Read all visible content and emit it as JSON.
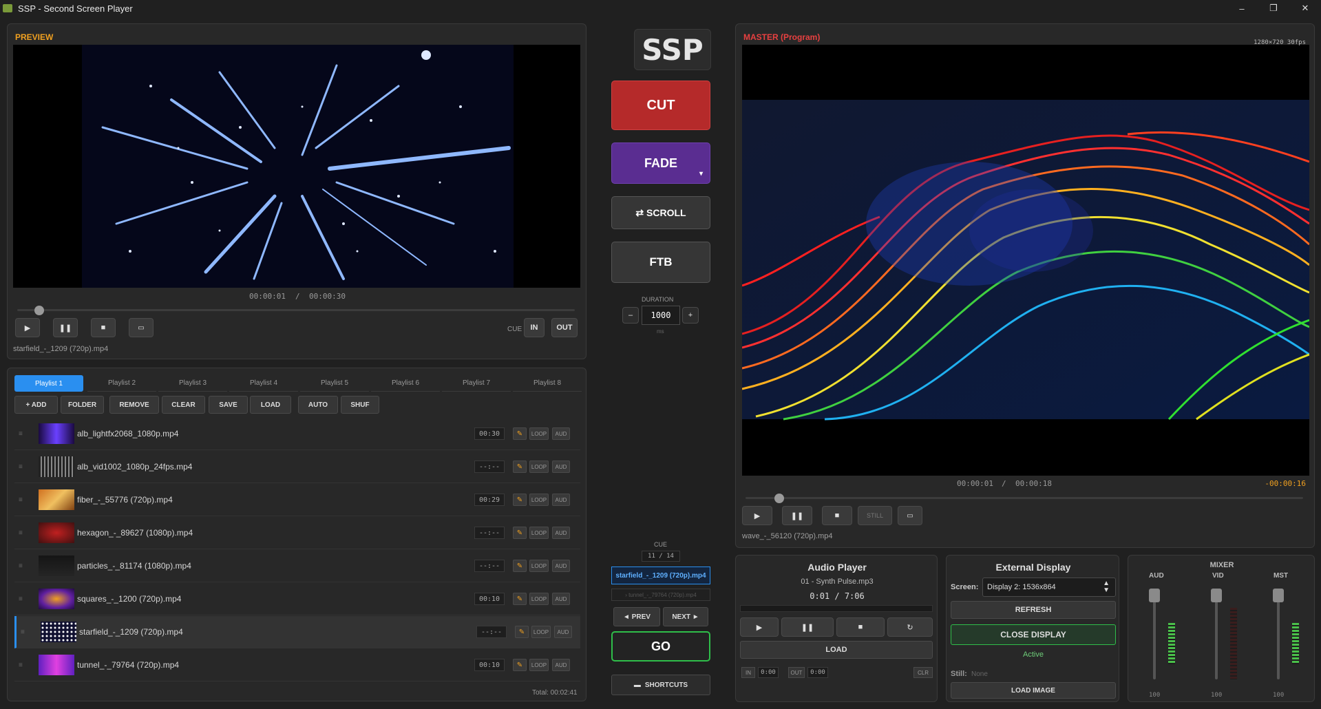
{
  "window": {
    "title": "SSP - Second Screen Player",
    "min": "–",
    "max": "❐",
    "close": "✕"
  },
  "preview": {
    "title": "PREVIEW",
    "time_current": "00:00:01",
    "time_sep": "/",
    "time_total": "00:00:30",
    "progress": 0.04,
    "filename": "starfield_-_1209 (720p).mp4",
    "cue_label": "CUE",
    "in_label": "IN",
    "out_label": "OUT"
  },
  "playlist": {
    "tabs": [
      "Playlist 1",
      "Playlist 2",
      "Playlist 3",
      "Playlist 4",
      "Playlist 5",
      "Playlist 6",
      "Playlist 7",
      "Playlist 8"
    ],
    "actions": [
      "+ ADD",
      "FOLDER",
      "REMOVE",
      "CLEAR",
      "SAVE",
      "LOAD",
      "AUTO",
      "SHUF"
    ],
    "loop_label": "LOOP",
    "aud_label": "AUD",
    "items": [
      {
        "name": "alb_lightfx2068_1080p.mp4",
        "duration": "00:30"
      },
      {
        "name": "alb_vid1002_1080p_24fps.mp4",
        "duration": "--:--"
      },
      {
        "name": "fiber_-_55776 (720p).mp4",
        "duration": "00:29"
      },
      {
        "name": "hexagon_-_89627 (1080p).mp4",
        "duration": "--:--"
      },
      {
        "name": "particles_-_81174 (1080p).mp4",
        "duration": "--:--"
      },
      {
        "name": "squares_-_1200 (720p).mp4",
        "duration": "00:10"
      },
      {
        "name": "starfield_-_1209 (720p).mp4",
        "duration": "--:--"
      },
      {
        "name": "tunnel_-_79764 (720p).mp4",
        "duration": "00:10"
      }
    ],
    "total": "Total: 00:02:41"
  },
  "center": {
    "logo": "SSP",
    "cut": "CUT",
    "fade": "FADE",
    "fade_arrow": "▾",
    "scroll": "⇄ SCROLL",
    "ftb": "FTB",
    "duration_label": "DURATION",
    "duration_value": "1000",
    "duration_unit": "ms",
    "minus": "–",
    "plus": "+",
    "cue_label": "CUE",
    "cue_count": "11 / 14",
    "cue_current": "starfield_-_1209 (720p).mp4",
    "cue_next": "› tunnel_-_79764 (720p).mp4",
    "prev": "◄ PREV",
    "next": "NEXT ►",
    "go": "GO",
    "shortcuts": "SHORTCUTS"
  },
  "master": {
    "title": "MASTER (Program)",
    "resolution": "1280×720 30fps",
    "time_current": "00:00:01",
    "time_sep": "/",
    "time_total": "00:00:18",
    "remaining": "-00:00:16",
    "progress": 0.06,
    "still_label": "STILL",
    "filename": "wave_-_56120 (720p).mp4"
  },
  "audio": {
    "title": "Audio Player",
    "track": "01 - Synth Pulse.mp3",
    "time": "0:01  /  7:06",
    "load": "LOAD",
    "in_label": "IN",
    "in_value": "0:00",
    "out_label": "OUT",
    "out_value": "0:00",
    "clr": "CLR"
  },
  "external": {
    "title": "External Display",
    "screen_label": "Screen:",
    "screen_value": "Display 2: 1536x864",
    "refresh": "REFRESH",
    "close_display": "CLOSE DISPLAY",
    "status": "Active",
    "still_label": "Still:",
    "still_value": "None",
    "load_image": "LOAD IMAGE"
  },
  "mixer": {
    "title": "MIXER",
    "channels": [
      {
        "label": "AUD",
        "value": "100"
      },
      {
        "label": "VID",
        "value": "100"
      },
      {
        "label": "MST",
        "value": "100"
      }
    ]
  },
  "colors": {
    "accent": "#2a8ff0",
    "cut": "#b52a2a",
    "fade": "#5a2d91",
    "go": "#2fbf4a",
    "preview_title": "#f0a020",
    "master_title": "#e84040"
  }
}
